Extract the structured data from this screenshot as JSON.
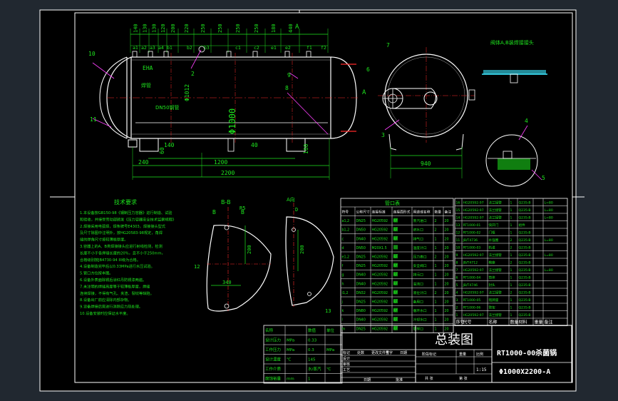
{
  "drawing": {
    "title_cn": "总装图",
    "product_name": "RT1000-00杀菌锅",
    "drawing_number": "Φ1000X2200-A",
    "section_bb": "B-B",
    "view_a": "A向",
    "note_section": "阀体A,B装焊接接头",
    "nozzle_table_title": "管口表",
    "tech_title": "技术要求",
    "label_a": "A",
    "label_a2": "A",
    "label_b": "B",
    "label_b2": "B"
  },
  "top_dims": [
    "140",
    "130",
    "130",
    "120",
    "200",
    "220",
    "250",
    "250",
    "250",
    "250",
    "180",
    "440"
  ],
  "nozzle_marks": [
    "a1",
    "a2",
    "a3",
    "a4",
    "b1",
    "b2",
    "b3",
    "c1",
    "c2",
    "e1",
    "e2",
    "f1",
    "f2"
  ],
  "side_dims": {
    "overall_len": "2200",
    "support_span": "1200",
    "left_dim": "240",
    "bottom_1": "140",
    "bottom_2": "60",
    "bottom_3": "40",
    "bottom_4": "160",
    "dia": "Φ1000",
    "dia_outer": "Φ1012",
    "end_view_width": "940",
    "pipe_note": "DN50钢管",
    "weld_note": "焊管",
    "end_cap": "EHA"
  },
  "balloons": [
    "10",
    "1",
    "2",
    "3",
    "4",
    "5",
    "6",
    "7",
    "8",
    "9",
    "11",
    "12"
  ],
  "section_dims": {
    "bb_width": "340",
    "bb_top": "R5",
    "bb_height": "200",
    "a_height": "200",
    "a_top": "D",
    "label_12": "12",
    "label_13": "13"
  },
  "tech_requirements": [
    "1.本设备按GB150-98《钢制压力容器》进行制造、试验",
    "和验收，并接受劳动部颁发《压力容器安全技术监察规程》",
    "2.焊接采用电弧焊，焊条牌号E4303，焊接接头型式",
    "及尺寸除图中注明外，按HG20583-98规定，角焊",
    "缝的焊角尺寸按较薄板厚度。",
    "3.容器上的A、B类焊接接头应进行射线检测，检测",
    "长度不小于各焊缝长度的20%，且不小于250mm，",
    "合格级别按JB4730-94 III级为合格。",
    "4.设备制造完毕后以0.33MPa进行水压试验。",
    "5.管口方位按本图。",
    "6.设备外表面除锈后涂红丹防锈漆两遍。",
    "7.未注明的焊缝高度等于较薄板厚度，焊缝",
    "连续焊接，不得有气孔、夹渣、裂纹等缺陷。",
    "8.设备出厂前应清除内部杂物。",
    "9.设备焊接后需进行消除应力热处理。",
    "10.设备安装时应保证水平度。"
  ],
  "spec_table": {
    "headers": [
      "名称",
      "",
      "数值",
      "单位"
    ],
    "rows": [
      [
        "设计压力",
        "MPa",
        "0.33",
        ""
      ],
      [
        "工作压力",
        "MPa",
        "0.3",
        "MPa"
      ],
      [
        "设计温度",
        "℃",
        "145",
        ""
      ],
      [
        "工作介质",
        "",
        "水/蒸汽",
        "℃"
      ],
      [
        "腐蚀裕量",
        "mm",
        "1",
        ""
      ]
    ]
  },
  "nozzle_table": {
    "headers": [
      "符号",
      "公称尺寸",
      "连接标准",
      "连接面形式",
      "用途或名称",
      "数量",
      "备注"
    ],
    "rows": [
      [
        "a1,2",
        "DN25",
        "HG20592",
        "RF",
        "蒸汽进口",
        "2",
        "20"
      ],
      [
        "b1,2",
        "DN50",
        "HG20592",
        "RF",
        "进水口",
        "2",
        "20"
      ],
      [
        "c",
        "DN40",
        "HG20592",
        "RF",
        "排气口",
        "1",
        "20"
      ],
      [
        "d",
        "DN50",
        "M20X1.5",
        "",
        "温度计口",
        "1",
        "20"
      ],
      [
        "e1,2",
        "DN25",
        "HG20592",
        "RF",
        "压力表口",
        "2",
        "20"
      ],
      [
        "f",
        "DN25",
        "HG20592",
        "RF",
        "安全阀口",
        "1",
        "20"
      ],
      [
        "g",
        "DN40",
        "HG20592",
        "RF",
        "排污口",
        "1",
        "20"
      ],
      [
        "h",
        "DN40",
        "HG20592",
        "RF",
        "溢流口",
        "1",
        "20"
      ],
      [
        "i1,2",
        "DN32",
        "HG20592",
        "RF",
        "液位计口",
        "2",
        "20"
      ],
      [
        "j",
        "DN25",
        "HG20592",
        "RF",
        "备用口",
        "1",
        "20"
      ],
      [
        "k",
        "DN80",
        "HG20592",
        "RF",
        "循环水口",
        "1",
        "20"
      ],
      [
        "l",
        "DN40",
        "HG20592",
        "RF",
        "冷却水口",
        "1",
        "20"
      ],
      [
        "m",
        "DN25",
        "HG20592",
        "RF",
        "取样口",
        "1",
        "20"
      ]
    ]
  },
  "bom_table": {
    "headers": [
      "序号",
      "代号",
      "名称",
      "数量",
      "材料",
      "重量",
      "备注"
    ],
    "rows": [
      [
        "16",
        "HG20592-97",
        "法兰接管",
        "1",
        "Q235-B",
        "",
        "L=80"
      ],
      [
        "15",
        "HG20592-97",
        "法兰接管",
        "1",
        "Q235-B",
        "",
        "L=80"
      ],
      [
        "14",
        "HG20592-97",
        "法兰接管",
        "1",
        "Q235-B",
        "",
        "L=80"
      ],
      [
        "13",
        "RT1000-01",
        "快开门",
        "1",
        "组件",
        "",
        ""
      ],
      [
        "12",
        "RT1000-02",
        "门框",
        "1",
        "Q235-B",
        "",
        ""
      ],
      [
        "11",
        "JB/T4736",
        "补强圈",
        "2",
        "Q235-B",
        "",
        "L=80"
      ],
      [
        "10",
        "RT1000-03",
        "轨道",
        "2",
        "Q235-B",
        "",
        ""
      ],
      [
        "9",
        "HG20592-97",
        "法兰接管",
        "1",
        "Q235-B",
        "",
        "L=80"
      ],
      [
        "8",
        "JB/T4712",
        "鞍座",
        "2",
        "Q235-B",
        "",
        ""
      ],
      [
        "7",
        "HG20592-97",
        "法兰接管",
        "1",
        "Q235-B",
        "",
        "L=80"
      ],
      [
        "6",
        "RT1000-04",
        "筒体",
        "1",
        "Q235-B",
        "",
        ""
      ],
      [
        "5",
        "JB/T4746",
        "封头",
        "1",
        "Q235-B",
        "",
        ""
      ],
      [
        "4",
        "HG20592-97",
        "法兰接管",
        "2",
        "Q235-B",
        "",
        ""
      ],
      [
        "3",
        "RT1000-05",
        "铭牌座",
        "1",
        "Q235-B",
        "",
        ""
      ],
      [
        "2",
        "RT1000-06",
        "管架",
        "1",
        "Q235-B",
        "",
        ""
      ],
      [
        "1",
        "HG20592-97",
        "法兰接管",
        "1",
        "Q235-B",
        "",
        ""
      ]
    ]
  },
  "title_block": {
    "labels_left": [
      "标记",
      "处数",
      "更改文件号",
      "签字",
      "日期"
    ],
    "design_row": [
      "设计",
      "",
      ""
    ],
    "check_row": [
      "审核",
      "",
      ""
    ],
    "process_row": [
      "工艺",
      "",
      ""
    ],
    "approve_row": [
      "日期",
      "",
      "批准"
    ],
    "stage_row": [
      "阶段标记",
      "重量",
      "比例"
    ],
    "scale": "1:15",
    "sheet_row": [
      "共  张",
      "第  张"
    ]
  },
  "colors": {
    "background": "#000000",
    "outer": "#212830",
    "frame": "#ffffff",
    "green": "#1ee61e",
    "red": "#ff2b2b",
    "magenta": "#ff40ff",
    "yellow": "#ffff40",
    "cyan": "#3ce8ff",
    "dim_green": "#2cd24a"
  }
}
